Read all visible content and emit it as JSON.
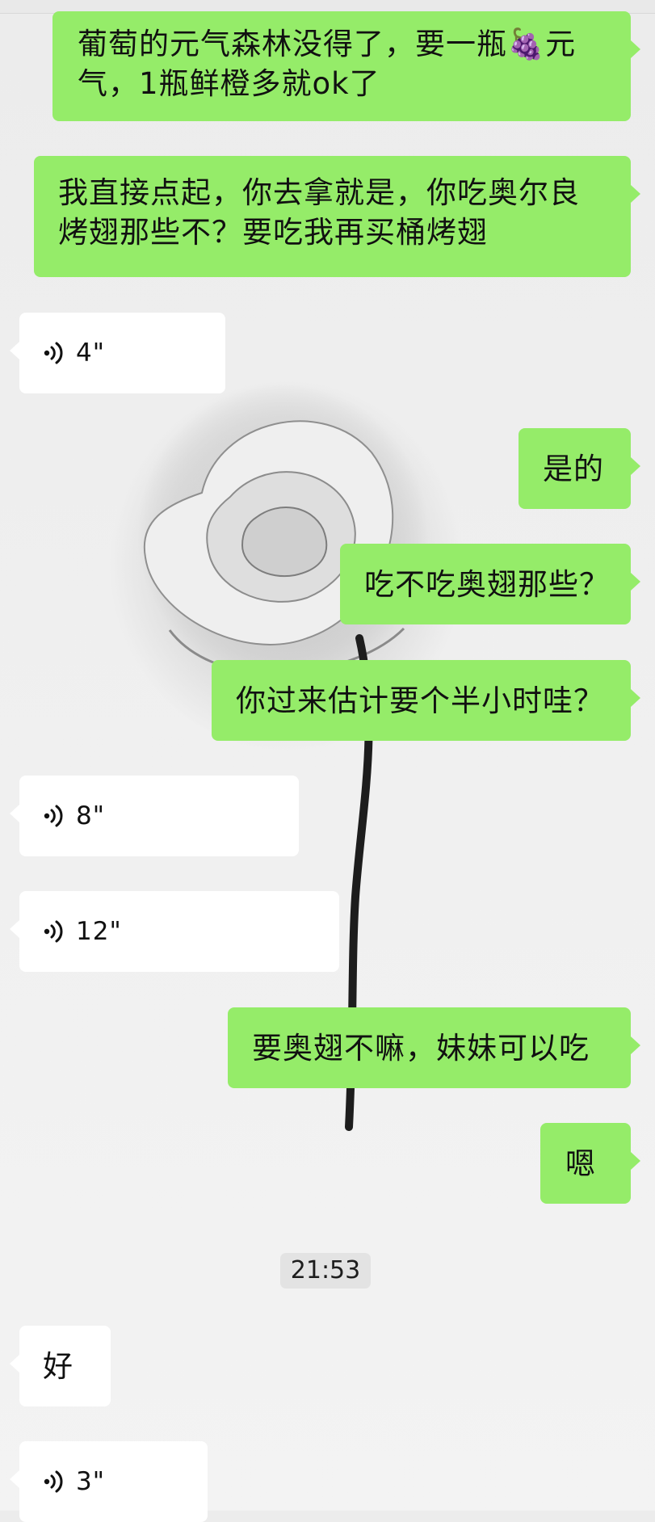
{
  "messages": [
    {
      "id": "m1",
      "side": "out",
      "type": "text",
      "text": "葡萄的元气森林没得了，要一瓶🍇元气，1瓶鲜橙多就ok了"
    },
    {
      "id": "m2",
      "side": "out",
      "type": "text",
      "text": "我直接点起，你去拿就是，你吃奥尔良烤翅那些不？要吃我再买桶烤翅"
    },
    {
      "id": "m3",
      "side": "in",
      "type": "voice",
      "duration": "4\""
    },
    {
      "id": "m4",
      "side": "out",
      "type": "text",
      "text": "是的"
    },
    {
      "id": "m5",
      "side": "out",
      "type": "text",
      "text": "吃不吃奥翅那些？"
    },
    {
      "id": "m6",
      "side": "out",
      "type": "text",
      "text": "你过来估计要个半小时哇？"
    },
    {
      "id": "m7",
      "side": "in",
      "type": "voice",
      "duration": "8\""
    },
    {
      "id": "m8",
      "side": "in",
      "type": "voice",
      "duration": "12\""
    },
    {
      "id": "m9",
      "side": "out",
      "type": "text",
      "text": "要奥翅不嘛，妹妹可以吃"
    },
    {
      "id": "m10",
      "side": "out",
      "type": "text",
      "text": "嗯"
    },
    {
      "id": "m11",
      "side": "in",
      "type": "text",
      "text": "好"
    },
    {
      "id": "m12",
      "side": "in",
      "type": "voice",
      "duration": "3\""
    }
  ],
  "timestamp": "21:53",
  "colors": {
    "outgoing_bubble": "#95ec69",
    "incoming_bubble": "#ffffff",
    "timestamp_bg": "#e3e3e3"
  },
  "icons": {
    "voice": "voice-wave-icon",
    "background": "rose-wallpaper"
  }
}
